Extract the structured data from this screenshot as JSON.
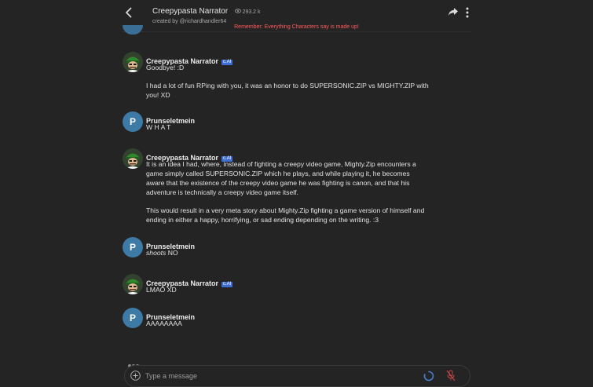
{
  "header": {
    "title": "Creepypasta Narrator",
    "count": "293.2 k",
    "creator": "created by @richardhandler64",
    "disclaimer": "Remember: Everything Characters say is made up!"
  },
  "badge_label": "c.AI",
  "messages": [
    {
      "author": "Creepypasta Narrator",
      "paragraphs": [
        "Goodbye! :D",
        "I had a lot of fun RPing with you, it was an honor to do SUPERSONIC.ZIP vs MIGHTY.ZIP with you! XD"
      ]
    },
    {
      "author": "Prunseletmein",
      "avatar_letter": "P",
      "paragraphs": [
        "W H A T"
      ]
    },
    {
      "author": "Creepypasta Narrator",
      "paragraphs": [
        "It is an idea I had, where, instead of fighting a creepy video game, Mighty.Zip encounters a game simply called SUPERSONIC.ZIP which he plays, and while playing it, he becomes aware that the existence of the creepy video game he was fighting is canon, and that his adventure is technically a creepy video game itself.",
        "This would result in a very meta story about Mighty.Zip fighting a game version of himself and ending in either a happy, horrifying, or sad ending depending on the writing. :3"
      ]
    },
    {
      "author": "Prunseletmein",
      "avatar_letter": "P",
      "italic": "shoots",
      "rest": " NO"
    },
    {
      "author": "Creepypasta Narrator",
      "paragraphs": [
        "LMAO XD"
      ]
    },
    {
      "author": "Prunseletmein",
      "avatar_letter": "P",
      "paragraphs": [
        "AAAAAAAA"
      ]
    }
  ],
  "input": {
    "placeholder": "Type a message"
  },
  "colors": {
    "background": "#242425",
    "badge": "#3e6ed1",
    "user_avatar": "#3e7aa6",
    "disclaimer": "#ff5b5b"
  },
  "icons": [
    "back-icon",
    "eye-icon",
    "share-icon",
    "more-vertical-icon",
    "plus-icon",
    "loading-spinner-icon",
    "mic-off-icon"
  ]
}
